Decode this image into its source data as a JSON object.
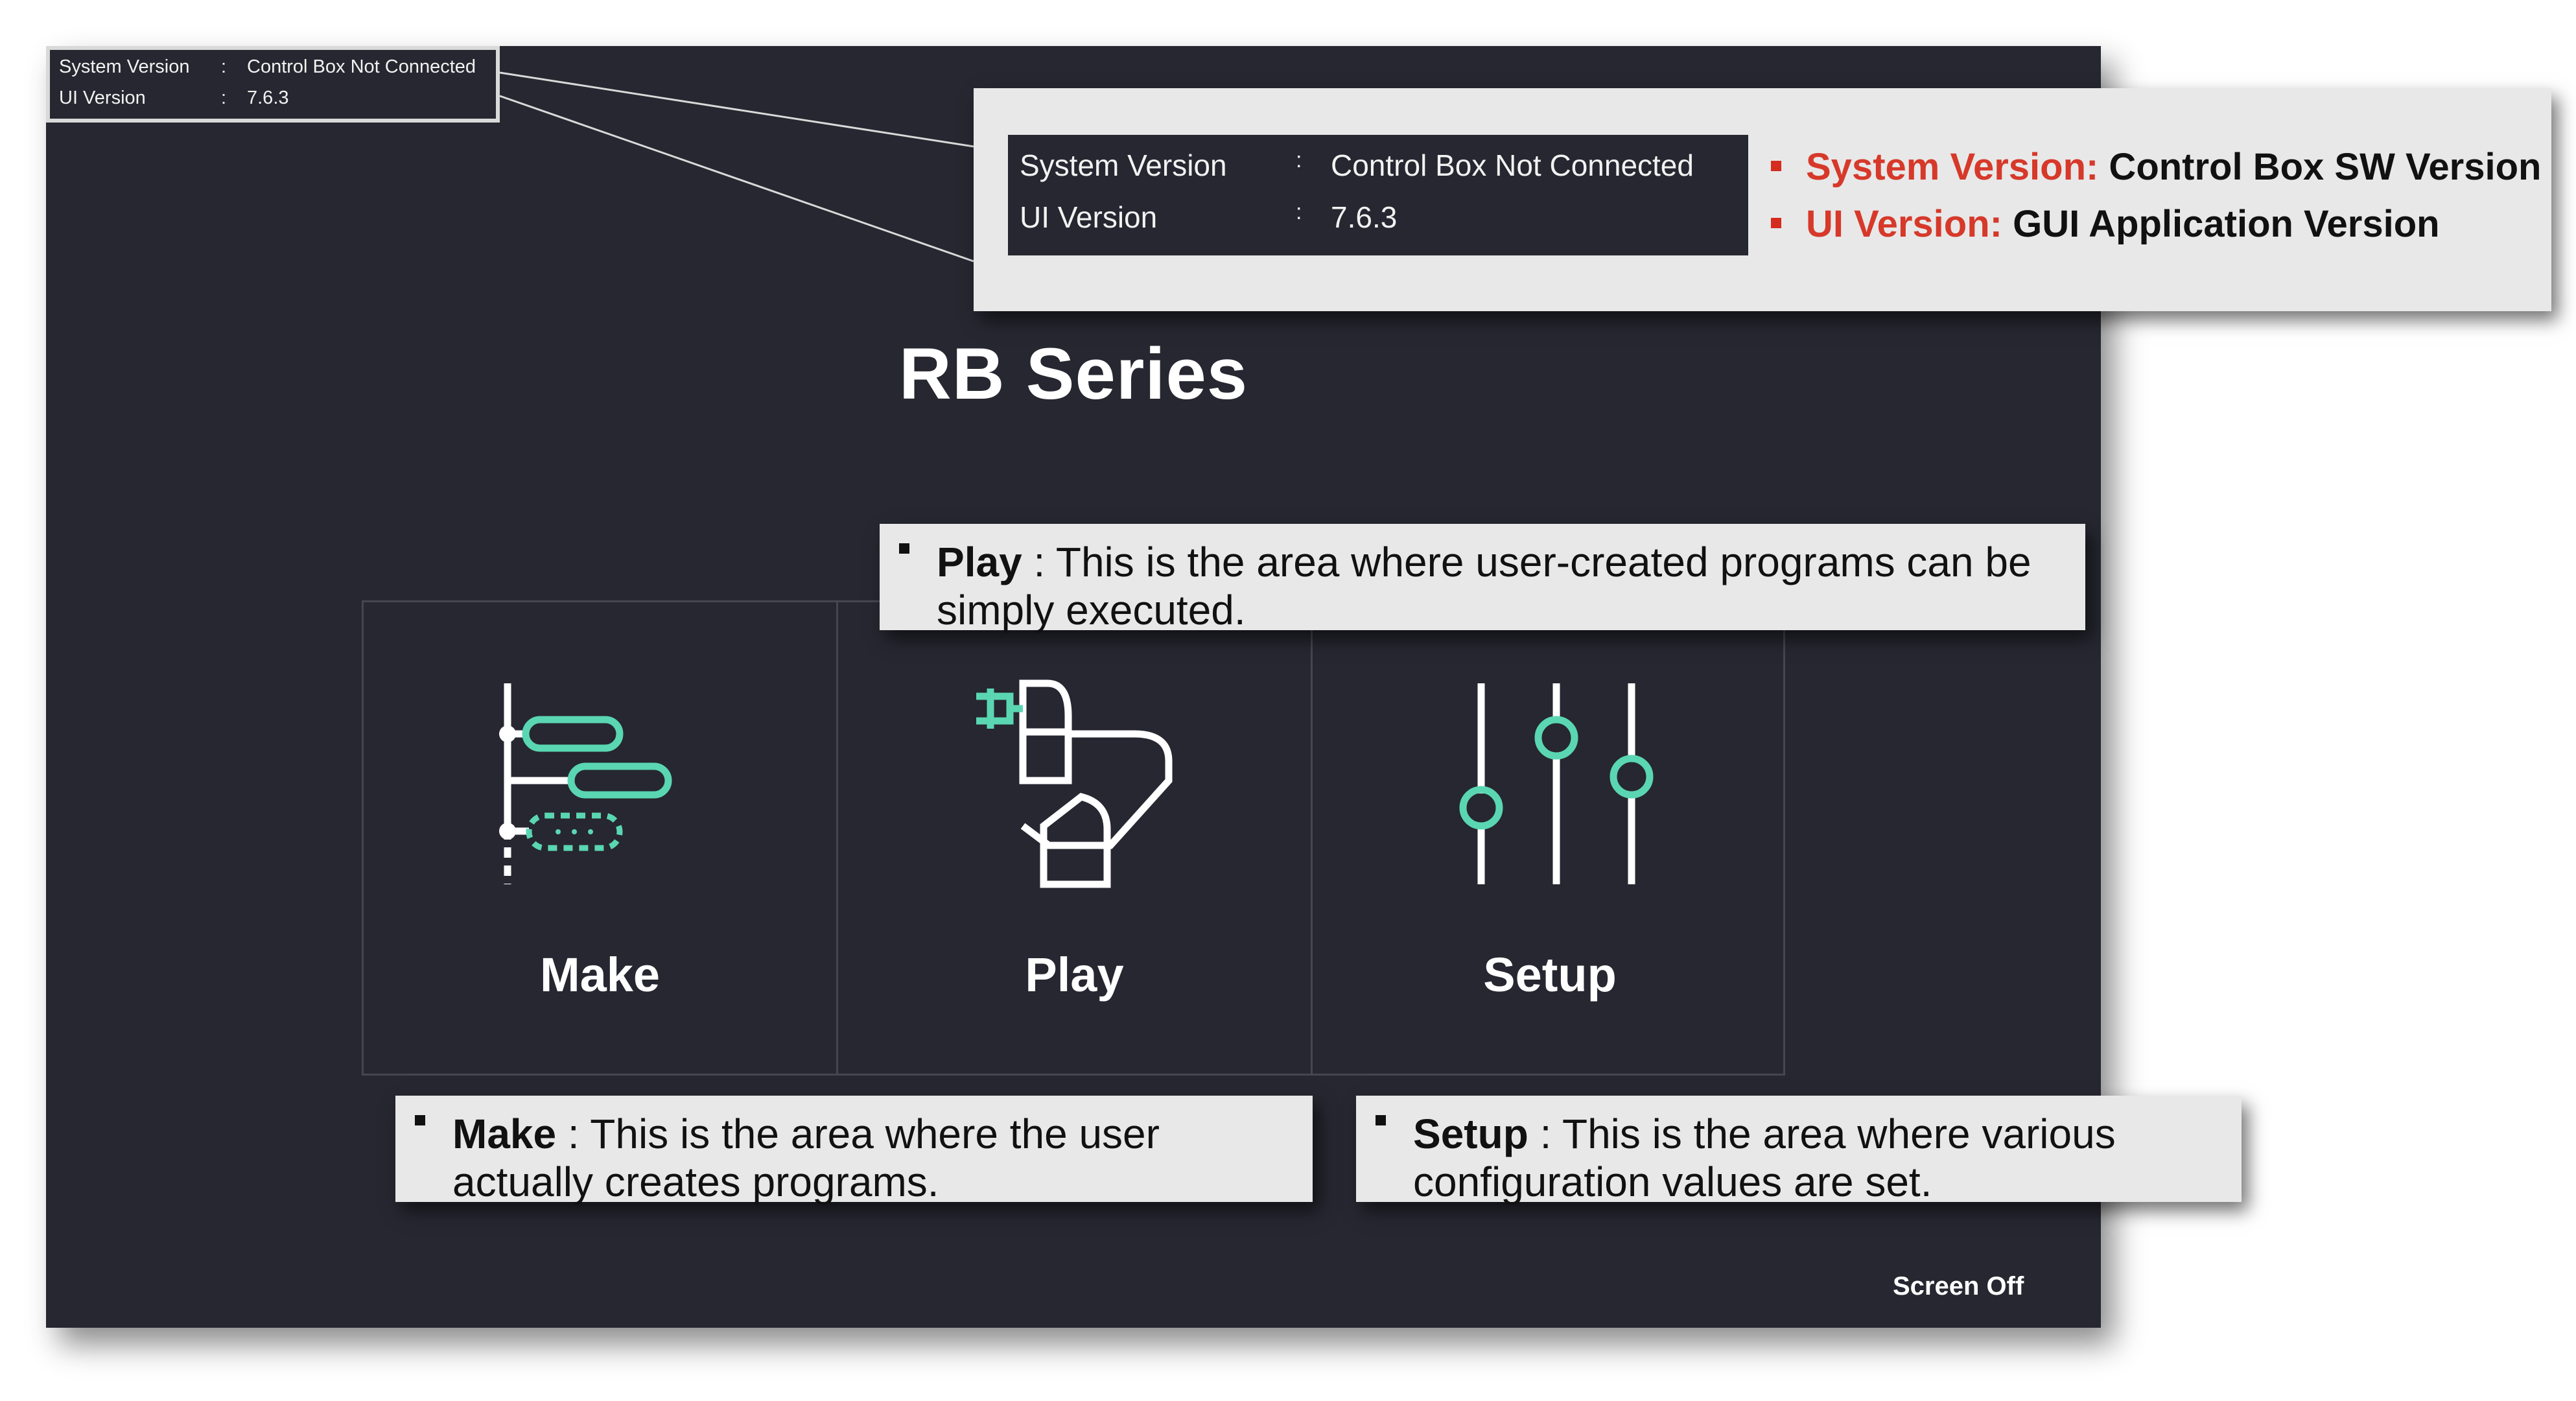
{
  "version_box": {
    "system_version_label": "System Version",
    "separator": ":",
    "system_version_value": "Control Box Not Connected",
    "ui_version_label": "UI Version",
    "ui_version_value": "7.6.3"
  },
  "version_callout": {
    "system_version_label": "System Version",
    "separator": ":",
    "system_version_value": "Control Box Not Connected",
    "ui_version_label": "UI Version",
    "ui_version_value": "7.6.3",
    "bullets": [
      {
        "key": "System Version:",
        "text": " Control Box SW Version"
      },
      {
        "key": "UI Version:",
        "text": " GUI Application Version"
      }
    ]
  },
  "title": "RB Series",
  "menu": {
    "make_label": "Make",
    "play_label": "Play",
    "setup_label": "Setup"
  },
  "descriptions": {
    "play": {
      "key": "Play",
      "text": " : This is the area where user-created programs can be simply executed."
    },
    "make": {
      "key": "Make",
      "text": " : This is the area where the user actually creates programs."
    },
    "setup": {
      "key": "Setup",
      "text": " : This is the area where various configuration values are set."
    }
  },
  "footer": {
    "screen_off": "Screen Off"
  },
  "icons": [
    "make-icon",
    "play-icon",
    "setup-icon"
  ],
  "colors": {
    "background": "#262730",
    "accent": "#5ad6b2",
    "callout_red": "#d6392a",
    "callout_bg": "#e8e8e8"
  }
}
